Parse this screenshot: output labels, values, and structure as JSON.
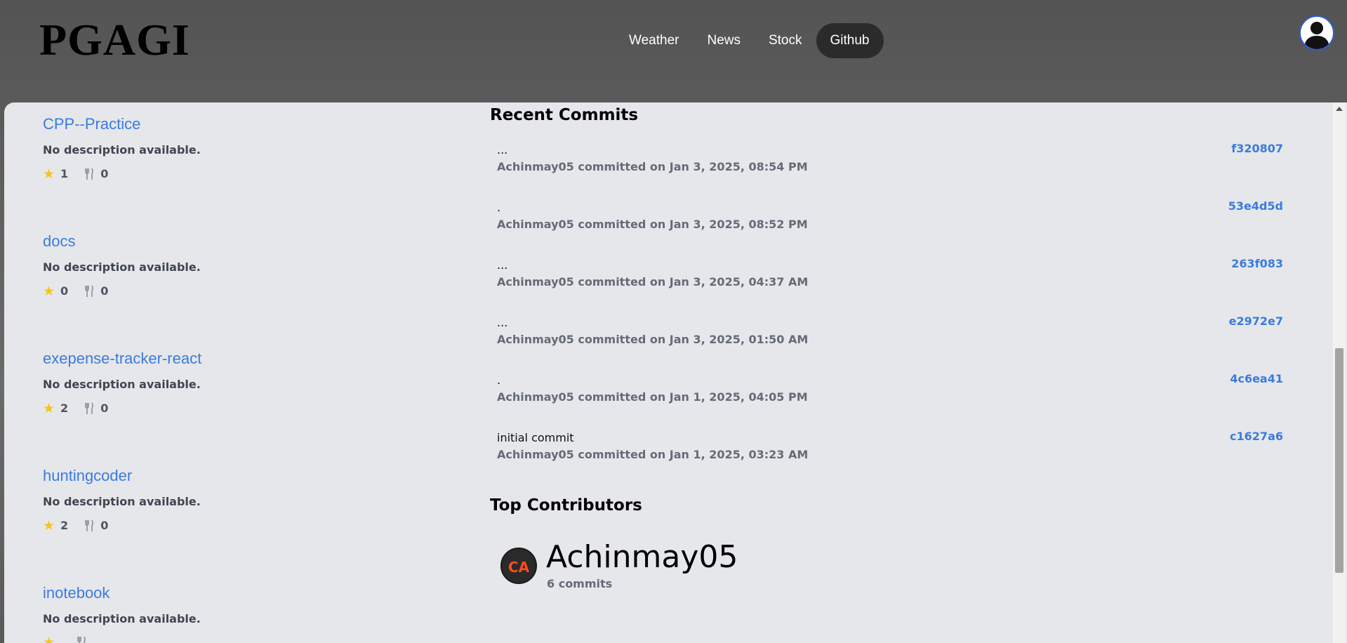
{
  "header": {
    "logo": "PGAGI",
    "nav": [
      "Weather",
      "News",
      "Stock",
      "Github"
    ],
    "active_nav": "Github"
  },
  "repos": [
    {
      "name": "CPP--Practice",
      "description": "No description available.",
      "stars": "1",
      "forks": "0"
    },
    {
      "name": "docs",
      "description": "No description available.",
      "stars": "0",
      "forks": "0"
    },
    {
      "name": "exepense-tracker-react",
      "description": "No description available.",
      "stars": "2",
      "forks": "0"
    },
    {
      "name": "huntingcoder",
      "description": "No description available.",
      "stars": "2",
      "forks": "0"
    },
    {
      "name": "inotebook",
      "description": "No description available.",
      "stars": "",
      "forks": ""
    }
  ],
  "recent_commits": {
    "title": "Recent Commits",
    "items": [
      {
        "message": "...",
        "meta": "Achinmay05 committed on Jan 3, 2025, 08:54 PM",
        "sha": "f320807"
      },
      {
        "message": ".",
        "meta": "Achinmay05 committed on Jan 3, 2025, 08:52 PM",
        "sha": "53e4d5d"
      },
      {
        "message": "...",
        "meta": "Achinmay05 committed on Jan 3, 2025, 04:37 AM",
        "sha": "263f083"
      },
      {
        "message": "...",
        "meta": "Achinmay05 committed on Jan 3, 2025, 01:50 AM",
        "sha": "e2972e7"
      },
      {
        "message": ".",
        "meta": "Achinmay05 committed on Jan 1, 2025, 04:05 PM",
        "sha": "4c6ea41"
      },
      {
        "message": "initial commit",
        "meta": "Achinmay05 committed on Jan 1, 2025, 03:23 AM",
        "sha": "c1627a6"
      }
    ]
  },
  "top_contributors": {
    "title": "Top Contributors",
    "items": [
      {
        "avatar_text": "CA",
        "name": "Achinmay05",
        "commits": "6 commits"
      }
    ]
  },
  "icons": {
    "star": "star-icon",
    "fork": "fork-icon",
    "profile": "user-avatar-icon"
  },
  "colors": {
    "link": "#3a7be0",
    "star": "#f5c518",
    "active_nav_bg": "#2b2b2b"
  }
}
